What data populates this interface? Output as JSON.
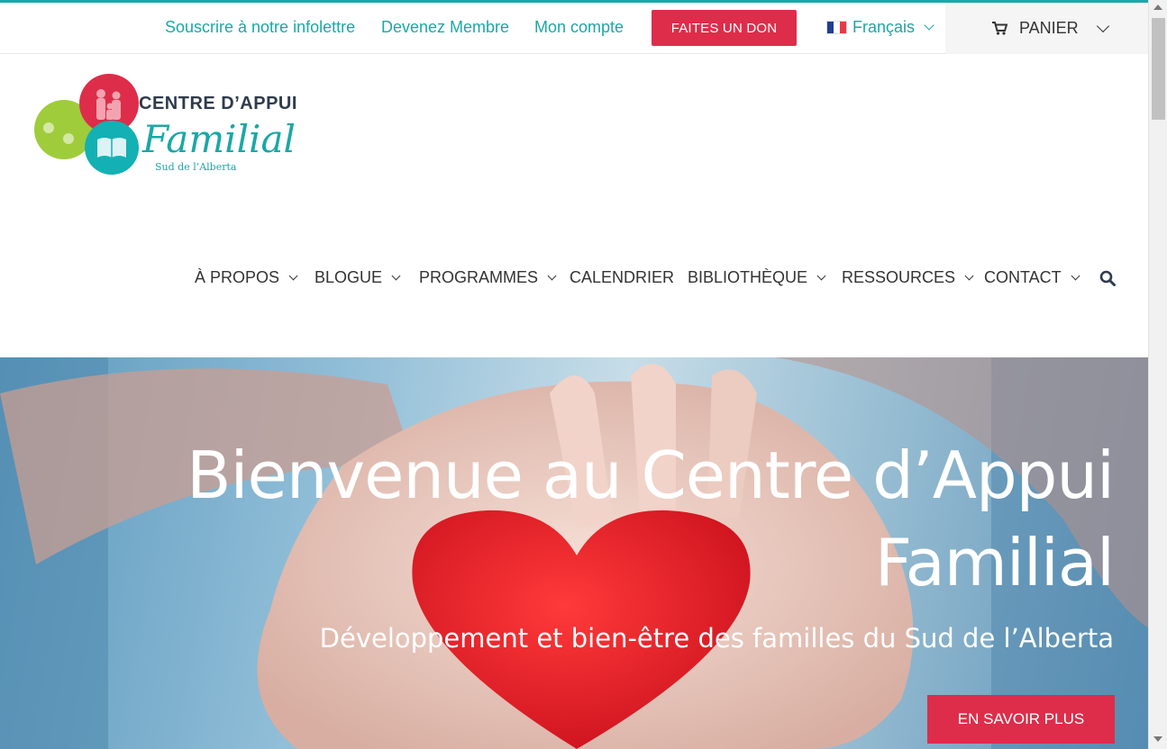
{
  "topbar": {
    "links": [
      {
        "label": "Souscrire à notre infolettre"
      },
      {
        "label": "Devenez Membre"
      },
      {
        "label": "Mon compte"
      }
    ],
    "donate_label": "FAITES UN DON",
    "language_label": "Français",
    "cart_label": "PANIER"
  },
  "logo": {
    "line1": "CENTRE D’APPUI",
    "line2": "Familial",
    "line3": "Sud de l’Alberta"
  },
  "nav": {
    "items": [
      {
        "label": "À PROPOS"
      },
      {
        "label": "BLOGUE"
      },
      {
        "label": "PROGRAMMES"
      },
      {
        "label": "CALENDRIER"
      },
      {
        "label": "BIBLIOTHÈQUE"
      },
      {
        "label": "RESSOURCES"
      },
      {
        "label": "CONTACT"
      }
    ]
  },
  "hero": {
    "title_line1": "Bienvenue au Centre d’Appui",
    "title_line2": "Familial",
    "subtitle": "Développement et bien-être des familles du Sud de l’Alberta",
    "button_label": "EN SAVOIR PLUS"
  },
  "colors": {
    "teal": "#1aa8a6",
    "red": "#dd2d4a",
    "lime": "#9fcc3b",
    "nav_text": "#333333"
  },
  "icons": [
    "france-flag-icon",
    "chevron-down-icon",
    "cart-icon",
    "search-icon",
    "logo-icon"
  ]
}
